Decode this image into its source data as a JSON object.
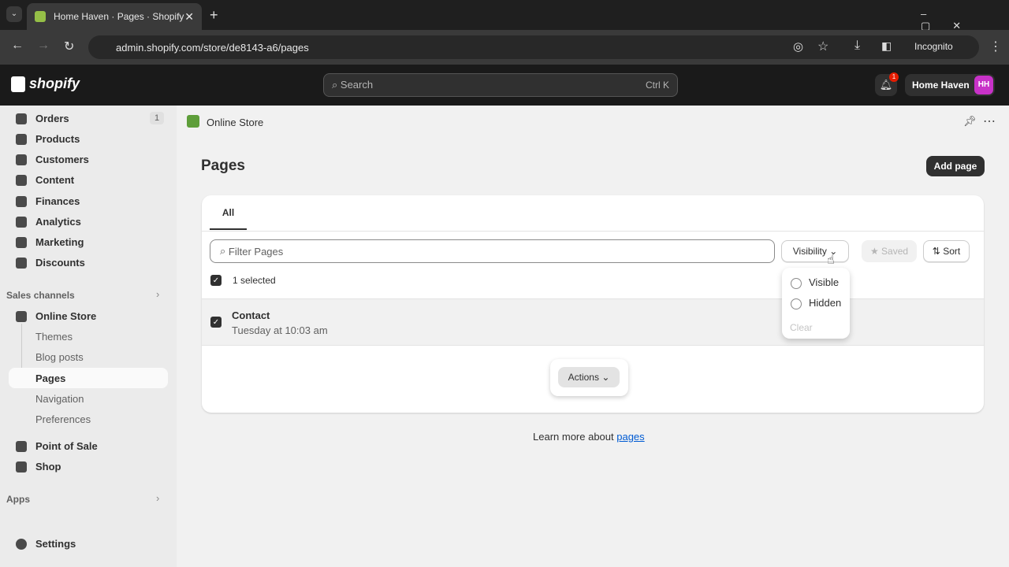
{
  "browser": {
    "tab_title": "Home Haven · Pages · Shopify",
    "url": "admin.shopify.com/store/de8143-a6/pages",
    "incognito": "Incognito"
  },
  "topbar": {
    "logo": "shopify",
    "search_placeholder": "Search",
    "shortcut": "Ctrl K",
    "notification_count": "1",
    "store_name": "Home Haven",
    "avatar": "HH"
  },
  "sidebar": {
    "items": [
      {
        "label": "Orders",
        "badge": "1"
      },
      {
        "label": "Products"
      },
      {
        "label": "Customers"
      },
      {
        "label": "Content"
      },
      {
        "label": "Finances"
      },
      {
        "label": "Analytics"
      },
      {
        "label": "Marketing"
      },
      {
        "label": "Discounts"
      }
    ],
    "sales_channels": "Sales channels",
    "online_store": "Online Store",
    "sub_items": [
      "Themes",
      "Blog posts",
      "Pages",
      "Navigation",
      "Preferences"
    ],
    "pos": "Point of Sale",
    "shop": "Shop",
    "apps": "Apps",
    "settings": "Settings"
  },
  "header": {
    "app": "Online Store",
    "title": "Pages",
    "add_page": "Add page"
  },
  "card": {
    "tab": "All",
    "filter_placeholder": "Filter Pages",
    "visibility": "Visibility",
    "saved": "Saved",
    "sort": "Sort",
    "selected": "1 selected",
    "rows": [
      {
        "title": "Contact",
        "date": "Tuesday at 10:03 am"
      }
    ],
    "actions": "Actions"
  },
  "dropdown": {
    "options": [
      "Visible",
      "Hidden"
    ],
    "clear": "Clear"
  },
  "footer": {
    "text": "Learn more about ",
    "link": "pages"
  }
}
